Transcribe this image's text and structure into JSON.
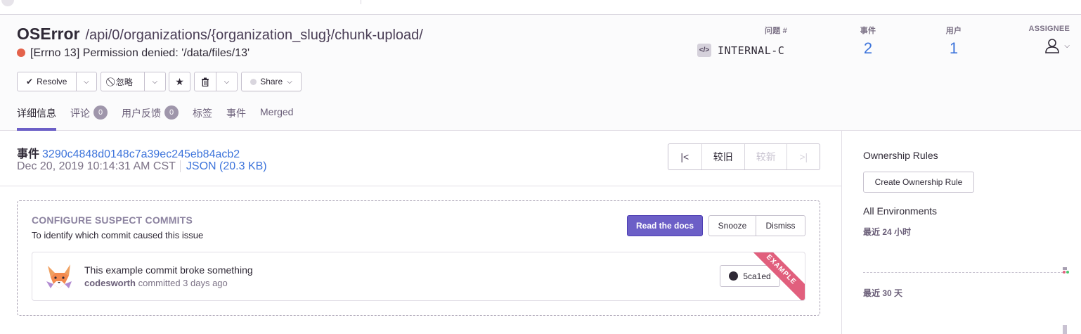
{
  "header": {
    "error_type": "OSError",
    "culprit": "/api/0/organizations/{organization_slug}/chunk-upload/",
    "message": "[Errno 13] Permission denied: '/data/files/13'",
    "level_color": "#e4624b",
    "actions": {
      "resolve": "Resolve",
      "ignore": "忽略",
      "share": "Share"
    },
    "stats": {
      "issue_label": "问题 #",
      "short_id": "INTERNAL-C",
      "events_label": "事件",
      "events_count": "2",
      "users_label": "用户",
      "users_count": "1",
      "assignee_label": "ASSIGNEE"
    },
    "tabs": [
      {
        "label": "详细信息"
      },
      {
        "label": "评论",
        "badge": "0"
      },
      {
        "label": "用户反馈",
        "badge": "0"
      },
      {
        "label": "标签"
      },
      {
        "label": "事件"
      },
      {
        "label": "Merged"
      }
    ]
  },
  "event": {
    "label": "事件",
    "id": "3290c4848d0148c7a39ec245eb84acb2",
    "date": "Dec 20, 2019 10:14:31 AM CST",
    "json_link": "JSON (20.3 KB)",
    "pager": {
      "older": "较旧",
      "newer": "较新"
    }
  },
  "suspect_commits": {
    "title": "CONFIGURE SUSPECT COMMITS",
    "description": "To identify which commit caused this issue",
    "read_docs": "Read the docs",
    "snooze": "Snooze",
    "dismiss": "Dismiss",
    "commit": {
      "message": "This example commit broke something",
      "author": "codesworth",
      "committed": "committed 3 days ago",
      "sha": "5ca1ed",
      "ribbon": "EXAMPLE"
    }
  },
  "sidebar": {
    "ownership_title": "Ownership Rules",
    "create_rule": "Create Ownership Rule",
    "environments_title": "All Environments",
    "range_24h": "最近 24 小时",
    "range_30d": "最近 30 天"
  },
  "colors": {
    "accent": "#6c5fc7",
    "link": "#3d74db",
    "ribbon": "#e15f7d"
  }
}
